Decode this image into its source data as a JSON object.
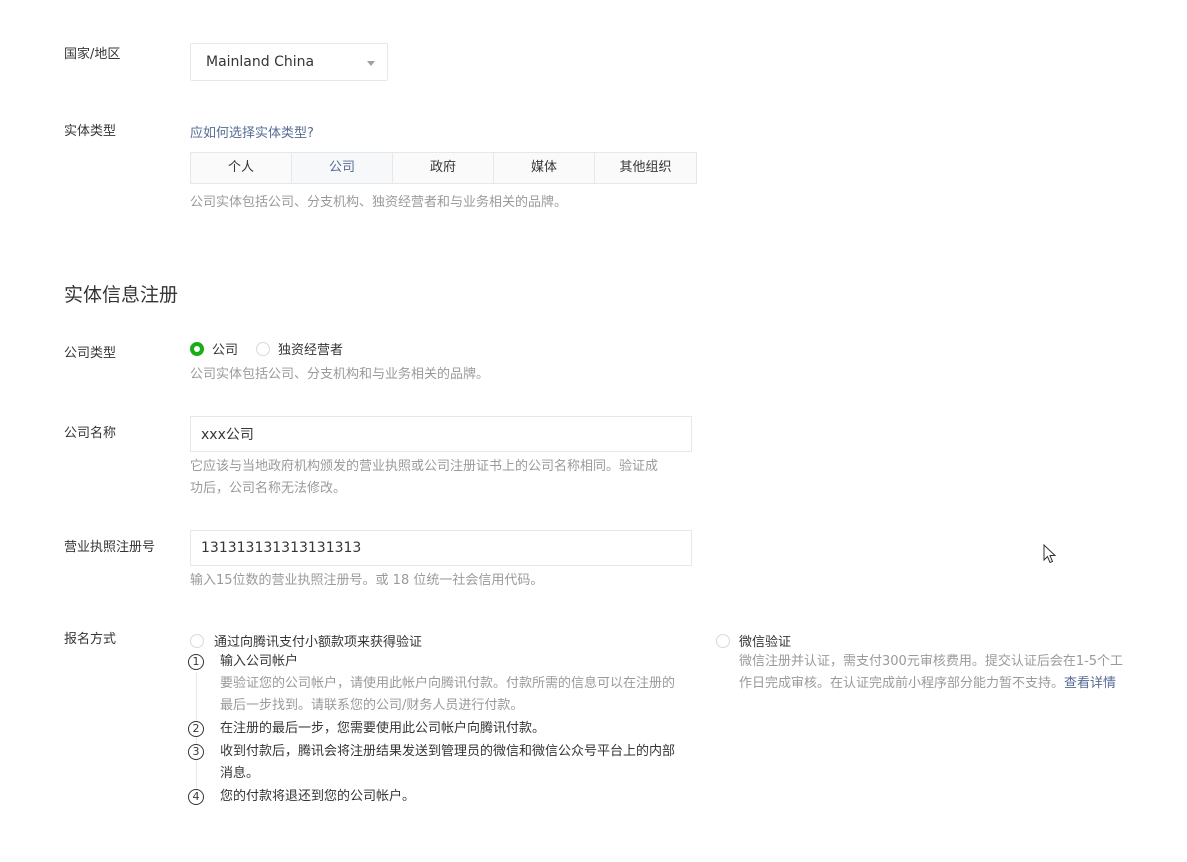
{
  "country": {
    "label": "国家/地区",
    "selected": "Mainland China"
  },
  "entity_type": {
    "label": "实体类型",
    "help_link": "应如何选择实体类型?",
    "tabs": [
      "个人",
      "公司",
      "政府",
      "媒体",
      "其他组织"
    ],
    "active_tab": "公司",
    "hint": "公司实体包括公司、分支机构、独资经营者和与业务相关的品牌。"
  },
  "section_title": "实体信息注册",
  "company_type": {
    "label": "公司类型",
    "options": [
      "公司",
      "独资经营者"
    ],
    "selected": "公司",
    "hint": "公司实体包括公司、分支机构和与业务相关的品牌。"
  },
  "company_name": {
    "label": "公司名称",
    "value": "xxx公司",
    "hint_line1": "它应该与当地政府机构颁发的营业执照或公司注册证书上的公司名称相同。验证成",
    "hint_line2": "功后，公司名称无法修改。"
  },
  "license": {
    "label": "营业执照注册号",
    "value": "131313131313131313",
    "hint": "输入15位数的营业执照注册号。或 18 位统一社会信用代码。"
  },
  "registration_method": {
    "label": "报名方式",
    "option_payment": "通过向腾讯支付小额款项来获得验证",
    "steps": [
      {
        "num": "1",
        "title": "输入公司帐户",
        "desc_line1": "要验证您的公司帐户，请使用此帐户向腾讯付款。付款所需的信息可以在注册的",
        "desc_line2": "最后一步找到。请联系您的公司/财务人员进行付款。"
      },
      {
        "num": "2",
        "title": "在注册的最后一步，您需要使用此公司帐户向腾讯付款。"
      },
      {
        "num": "3",
        "title_line1": "收到付款后，腾讯会将注册结果发送到管理员的微信和微信公众号平台上的内部",
        "title_line2": "消息。"
      },
      {
        "num": "4",
        "title": "您的付款将退还到您的公司帐户。"
      }
    ],
    "option_wechat": "微信验证",
    "wechat_desc_line1": "微信注册并认证，需支付300元审核费用。提交认证后会在1-5个工",
    "wechat_desc_line2": "作日完成审核。在认证完成前小程序部分能力暂不支持。",
    "wechat_link": "查看详情"
  },
  "colors": {
    "accent_green": "#1aad19",
    "link_blue": "#576b95",
    "hint_gray": "#9a9a9a"
  }
}
